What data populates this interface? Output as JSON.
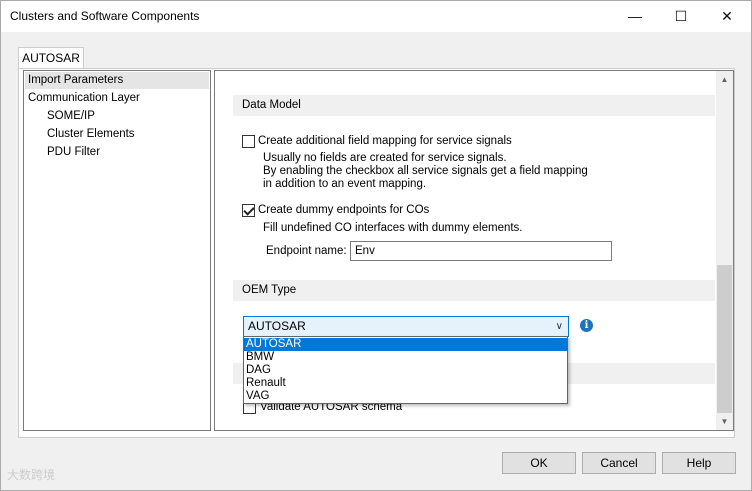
{
  "window": {
    "title": "Clusters and Software Components",
    "minimize_icon": "minimize-icon",
    "maximize_icon": "maximize-icon",
    "close_icon": "close-icon"
  },
  "tabs": [
    {
      "label": "AUTOSAR",
      "active": true
    }
  ],
  "tree": {
    "items": [
      {
        "label": "Import Parameters",
        "selected": true
      },
      {
        "label": "Communication Layer"
      },
      {
        "label": "SOME/IP"
      },
      {
        "label": "Cluster Elements"
      },
      {
        "label": "PDU Filter"
      }
    ]
  },
  "data_model": {
    "header": "Data Model",
    "field_mapping": {
      "label": "Create additional field mapping for service signals",
      "checked": false,
      "desc_line1": "Usually no fields are created for service signals.",
      "desc_line2": "By enabling the checkbox all service signals get a field mapping",
      "desc_line3": "in addition to an event mapping."
    },
    "dummy_endpoints": {
      "label": "Create dummy endpoints for COs",
      "checked": true,
      "desc": "Fill undefined CO interfaces with dummy elements.",
      "endpoint_label": "Endpoint name:",
      "endpoint_value": "Env"
    }
  },
  "oem_type": {
    "header": "OEM Type",
    "selected": "AUTOSAR",
    "options": [
      "AUTOSAR",
      "BMW",
      "DAG",
      "Renault",
      "VAG"
    ],
    "info_icon": "info-icon",
    "info_glyph": "i"
  },
  "validation": {
    "label": "Validate AUTOSAR schema",
    "checked": false
  },
  "buttons": {
    "ok": "OK",
    "cancel": "Cancel",
    "help": "Help"
  },
  "watermark": "大数跨境"
}
